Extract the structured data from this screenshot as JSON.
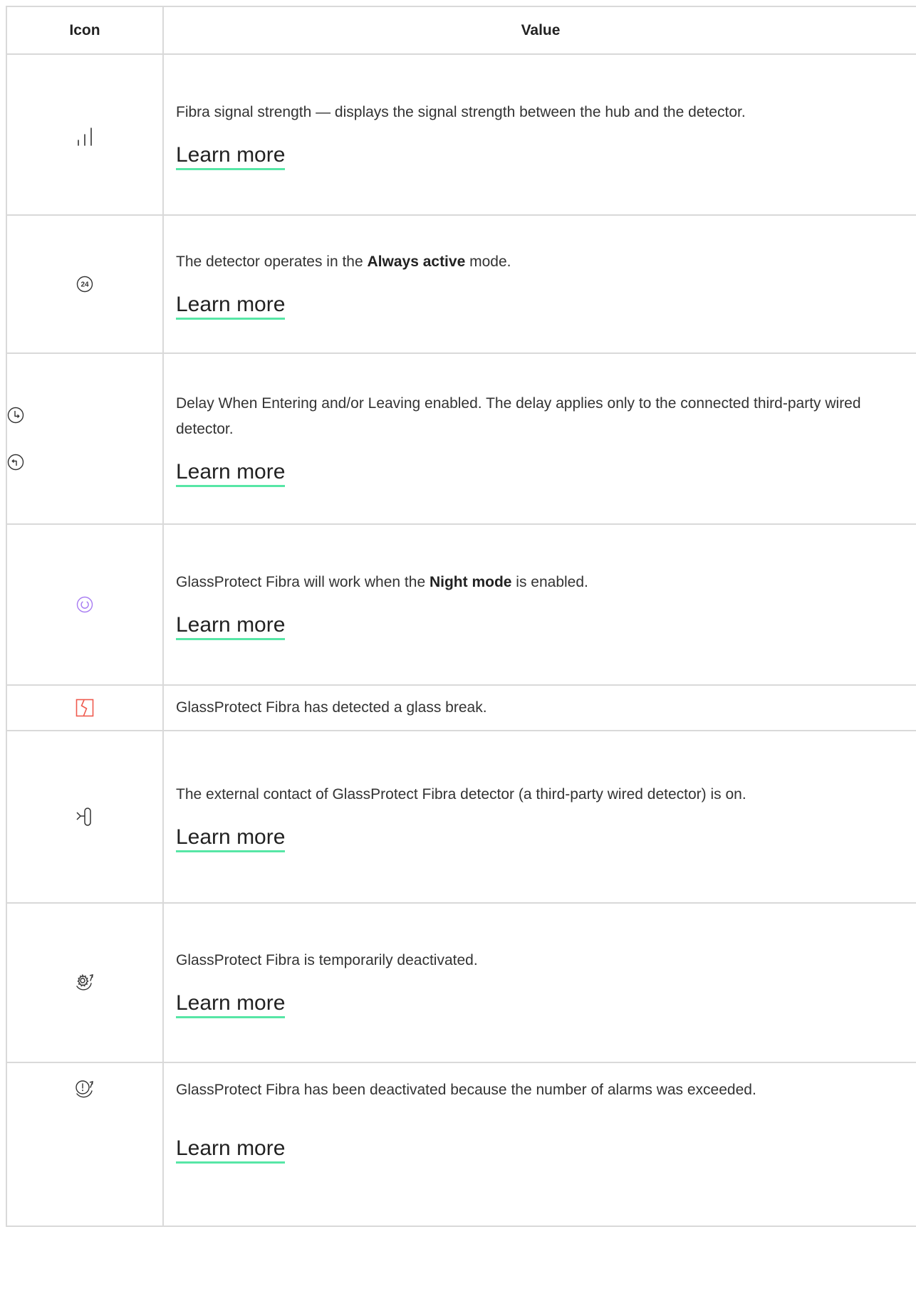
{
  "header": {
    "icon": "Icon",
    "value": "Value"
  },
  "rows": [
    {
      "icons": [
        "signal-strength-icon"
      ],
      "text_before": "Fibra signal strength — displays the signal strength between the hub and the detector.",
      "bold": "",
      "text_after": "",
      "link": "Learn more"
    },
    {
      "icons": [
        "always-active-24-icon"
      ],
      "text_before": "The detector operates in the ",
      "bold": "Always active",
      "text_after": " mode.",
      "link": "Learn more"
    },
    {
      "icons": [
        "delay-entering-icon",
        "delay-leaving-icon"
      ],
      "text_before": "Delay When Entering and/or Leaving enabled. The delay applies only to the connected third-party wired detector.",
      "bold": "",
      "text_after": "",
      "link": "Learn more"
    },
    {
      "icons": [
        "night-mode-icon"
      ],
      "text_before": "GlassProtect Fibra will work when the ",
      "bold": "Night mode",
      "text_after": " is enabled.",
      "link": "Learn more"
    },
    {
      "icons": [
        "glass-break-icon"
      ],
      "text_before": "GlassProtect Fibra has detected a glass break.",
      "bold": "",
      "text_after": "",
      "link": ""
    },
    {
      "icons": [
        "external-contact-icon"
      ],
      "text_before": "The external contact of GlassProtect Fibra detector (a third-party wired detector) is on.",
      "bold": "",
      "text_after": "",
      "link": "Learn more"
    },
    {
      "icons": [
        "temporarily-deactivated-icon"
      ],
      "text_before": "GlassProtect Fibra is temporarily deactivated.",
      "bold": "",
      "text_after": "",
      "link": "Learn more"
    },
    {
      "icons": [
        "alarms-exceeded-icon"
      ],
      "text_before": "GlassProtect Fibra has been deactivated because the number of alarms was exceeded.",
      "bold": "",
      "text_after": "",
      "link": "Learn more"
    }
  ],
  "colors": {
    "border": "#d9d9d9",
    "link_underline": "#57e6a6",
    "night_mode_icon": "#a77bf2",
    "glass_break_icon": "#ef5a4e"
  }
}
